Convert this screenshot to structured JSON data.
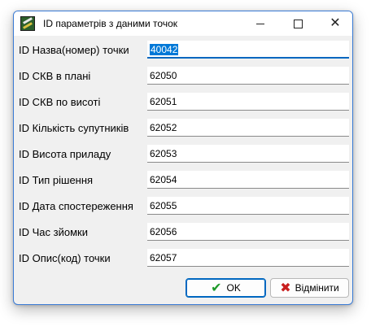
{
  "window": {
    "title": "ID параметрів з даними точок"
  },
  "fields": [
    {
      "label": "ID Назва(номер) точки",
      "value": "40042"
    },
    {
      "label": "ID СКВ в плані",
      "value": "62050"
    },
    {
      "label": "ID СКВ по висоті",
      "value": "62051"
    },
    {
      "label": "ID Кількість супутників",
      "value": "62052"
    },
    {
      "label": "ID Висота приладу",
      "value": "62053"
    },
    {
      "label": "ID Тип рішення",
      "value": "62054"
    },
    {
      "label": "ID Дата спостереження",
      "value": "62055"
    },
    {
      "label": "ID Час зйомки",
      "value": "62056"
    },
    {
      "label": "ID Опис(код) точки",
      "value": "62057"
    }
  ],
  "buttons": {
    "ok": "OK",
    "cancel": "Відмінити"
  },
  "icons": {
    "app": "app-icon",
    "ok": "check-icon",
    "cancel": "x-icon"
  },
  "colors": {
    "accent": "#0078d7",
    "ok_icon": "#1e9a2a",
    "cancel_icon": "#c81e1e"
  }
}
